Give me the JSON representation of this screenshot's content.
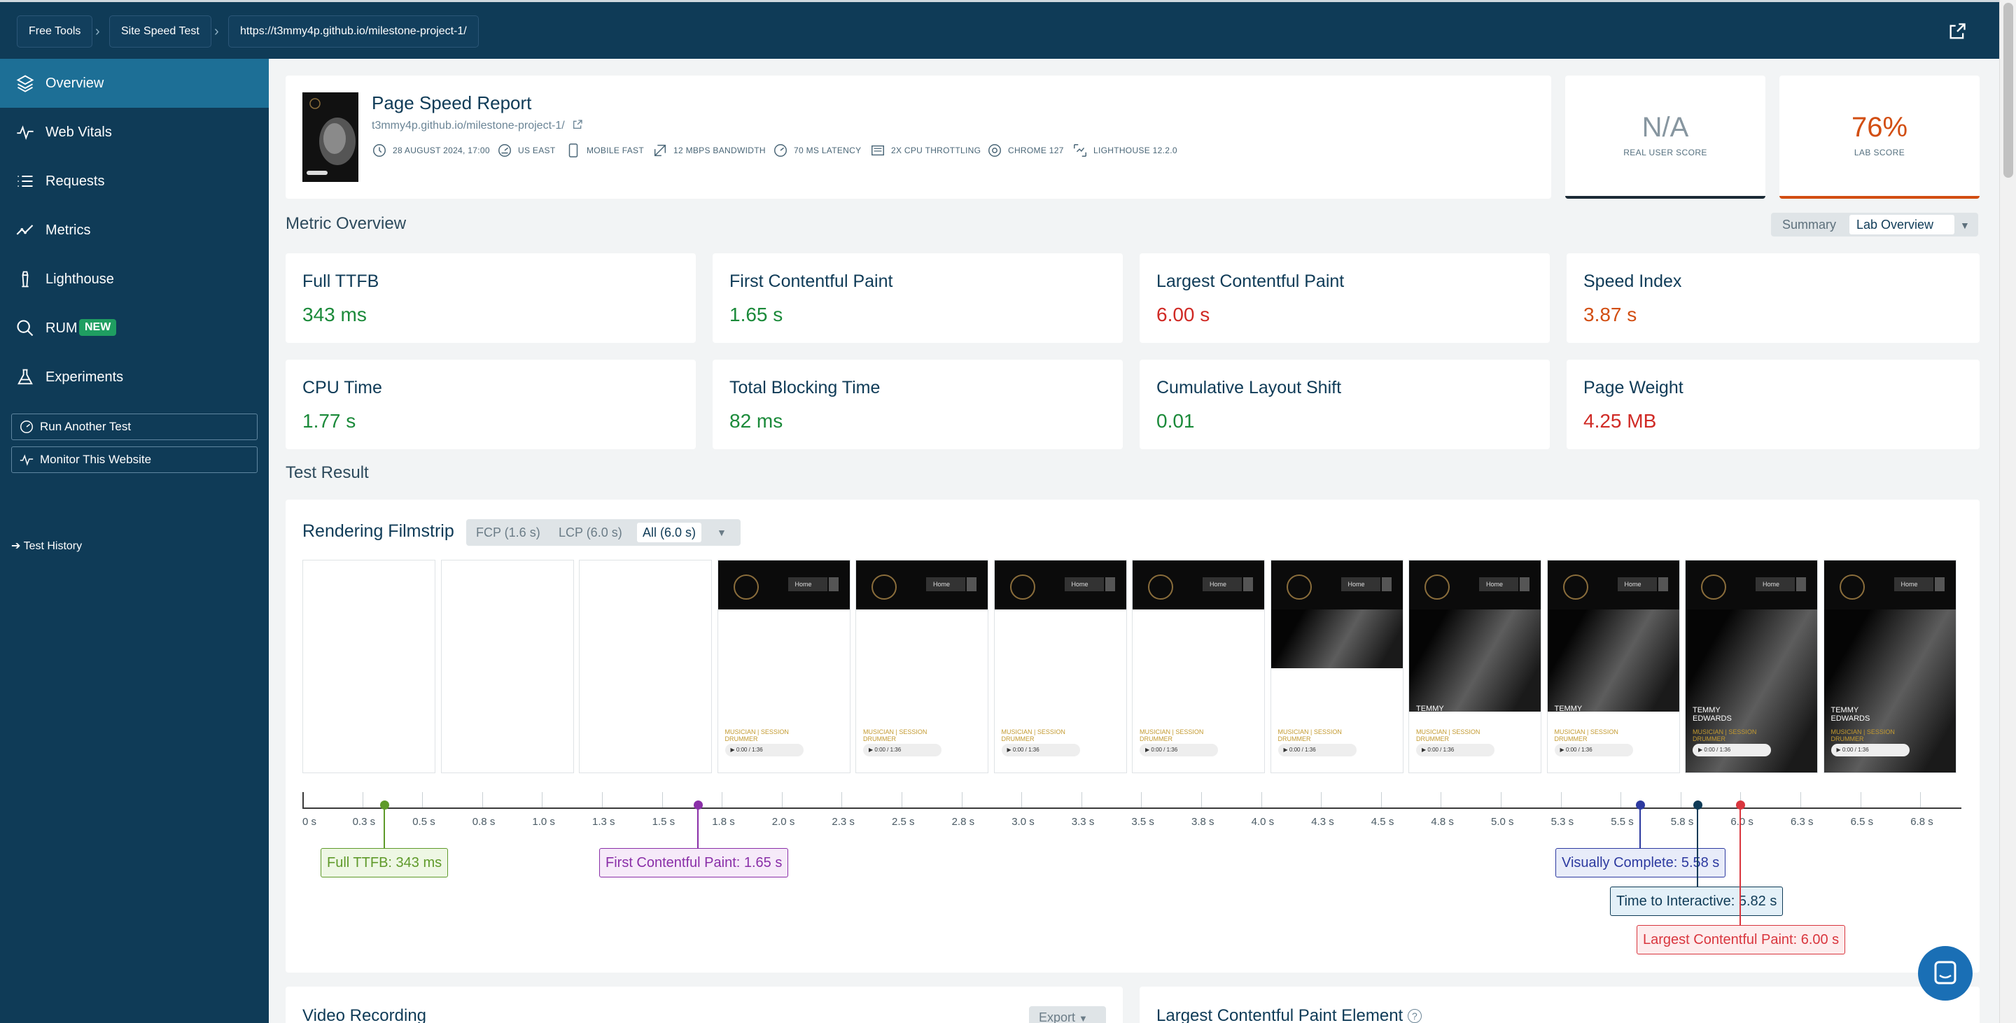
{
  "breadcrumbs": [
    "Free Tools",
    "Site Speed Test",
    "https://t3mmy4p.github.io/milestone-project-1/"
  ],
  "nav": [
    {
      "label": "Overview",
      "icon": "layers-icon",
      "active": true
    },
    {
      "label": "Web Vitals",
      "icon": "pulse-icon"
    },
    {
      "label": "Requests",
      "icon": "list-icon"
    },
    {
      "label": "Metrics",
      "icon": "chart-line-icon"
    },
    {
      "label": "Lighthouse",
      "icon": "lighthouse-icon"
    },
    {
      "label": "RUM",
      "icon": "search-icon",
      "badge": "NEW"
    },
    {
      "label": "Experiments",
      "icon": "flask-icon"
    }
  ],
  "sidebar_buttons": {
    "run": "Run Another Test",
    "monitor": "Monitor This Website",
    "history": "Test History"
  },
  "report": {
    "title": "Page Speed Report",
    "url": "t3mmy4p.github.io/milestone-project-1/",
    "meta": [
      {
        "icon": "clock-icon",
        "text": "28 AUGUST 2024, 17:00"
      },
      {
        "icon": "globe-icon",
        "text": "US EAST"
      },
      {
        "icon": "mobile-icon",
        "text": "MOBILE FAST"
      },
      {
        "icon": "bandwidth-icon",
        "text": "12 MBPS BANDWIDTH"
      },
      {
        "icon": "gauge-icon",
        "text": "70 MS LATENCY"
      },
      {
        "icon": "cpu-icon",
        "text": "2X CPU THROTTLING"
      },
      {
        "icon": "chrome-icon",
        "text": "CHROME 127"
      },
      {
        "icon": "lighthouse-icon",
        "text": "LIGHTHOUSE 12.2.0"
      }
    ]
  },
  "scores": {
    "rum_value": "N/A",
    "rum_label": "REAL USER SCORE",
    "lab_value": "76%",
    "lab_label": "LAB SCORE",
    "lab_fraction": 0.76
  },
  "metric_overview": {
    "title": "Metric Overview",
    "toggle": {
      "summary": "Summary",
      "lab": "Lab Overview"
    },
    "metrics": [
      {
        "name": "Full TTFB",
        "value": "343 ms",
        "status": "good"
      },
      {
        "name": "First Contentful Paint",
        "value": "1.65 s",
        "status": "good"
      },
      {
        "name": "Largest Contentful Paint",
        "value": "6.00 s",
        "status": "poor"
      },
      {
        "name": "Speed Index",
        "value": "3.87 s",
        "status": "needs-improvement"
      },
      {
        "name": "CPU Time",
        "value": "1.77 s",
        "status": "good"
      },
      {
        "name": "Total Blocking Time",
        "value": "82 ms",
        "status": "good"
      },
      {
        "name": "Cumulative Layout Shift",
        "value": "0.01",
        "status": "good"
      },
      {
        "name": "Page Weight",
        "value": "4.25 MB",
        "status": "poor"
      }
    ]
  },
  "test_result": {
    "title": "Test Result",
    "filmstrip": {
      "title": "Rendering Filmstrip",
      "options": [
        "FCP (1.6 s)",
        "LCP (6.0 s)",
        "All (6.0 s)"
      ],
      "selected": "All (6.0 s)"
    },
    "frame_text": {
      "menu": "Home",
      "tagline1": "MUSICIAN | SESSION",
      "tagline2": "DRUMMER",
      "player": "0:00 / 1:36",
      "name1": "TEMMY",
      "name2": "EDWARDS"
    },
    "timeline_ticks": [
      "0 s",
      "0.3 s",
      "0.5 s",
      "0.8 s",
      "1.0 s",
      "1.3 s",
      "1.5 s",
      "1.8 s",
      "2.0 s",
      "2.3 s",
      "2.5 s",
      "2.8 s",
      "3.0 s",
      "3.3 s",
      "3.5 s",
      "3.8 s",
      "4.0 s",
      "4.3 s",
      "4.5 s",
      "4.8 s",
      "5.0 s",
      "5.3 s",
      "5.5 s",
      "5.8 s",
      "6.0 s",
      "6.3 s",
      "6.5 s",
      "6.8 s"
    ],
    "markers": [
      {
        "label": "Full TTFB: 343 ms",
        "time": 0.343,
        "color": "#5f9a2a",
        "bg": "#eef7e4"
      },
      {
        "label": "First Contentful Paint: 1.65 s",
        "time": 1.65,
        "color": "#8a2fa8",
        "bg": "#f6eaf9"
      },
      {
        "label": "Visually Complete: 5.58 s",
        "time": 5.58,
        "color": "#2d3aa0",
        "bg": "#e8ecf9"
      },
      {
        "label": "Time to Interactive: 5.82 s",
        "time": 5.82,
        "color": "#0f3b57",
        "bg": "#e3f0f8"
      },
      {
        "label": "Largest Contentful Paint: 6.00 s",
        "time": 6.0,
        "color": "#d9363e",
        "bg": "#fdeced"
      }
    ]
  },
  "bottom": {
    "video": "Video Recording",
    "export": "Export",
    "lcp_element": "Largest Contentful Paint Element"
  }
}
